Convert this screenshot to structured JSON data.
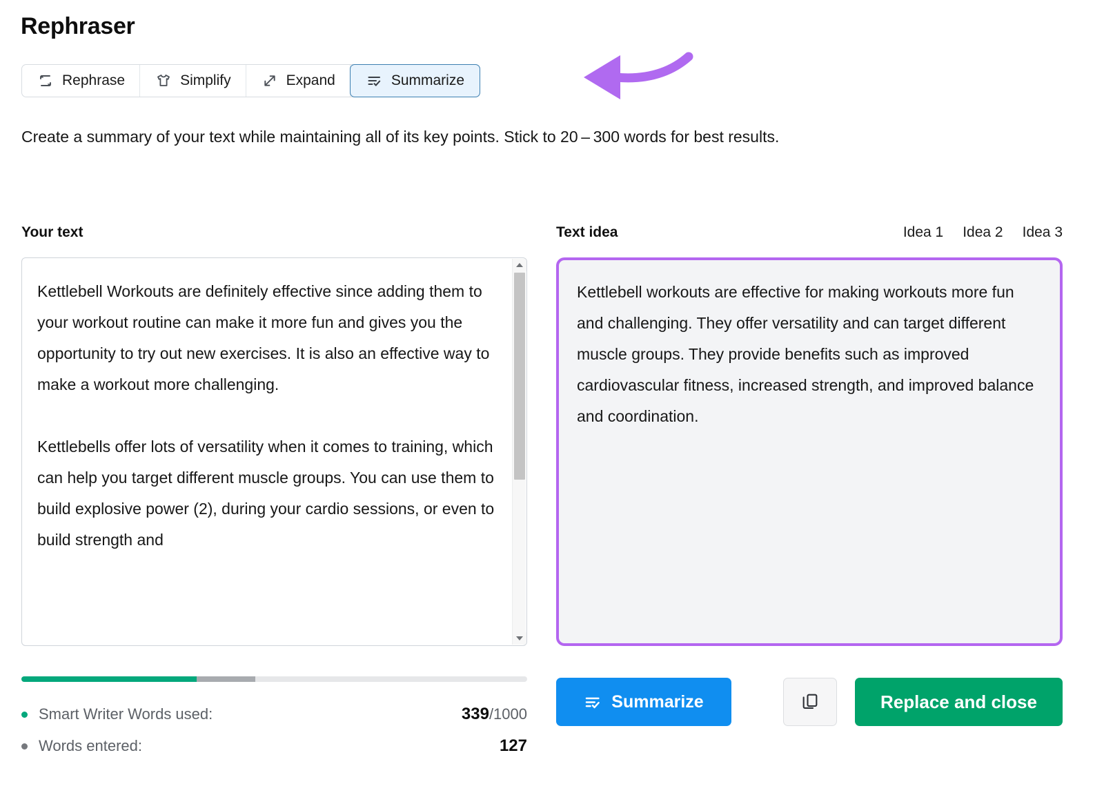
{
  "header": {
    "title": "Rephraser"
  },
  "tabs": [
    {
      "label": "Rephrase",
      "icon": "rephrase-loop-icon",
      "active": false
    },
    {
      "label": "Simplify",
      "icon": "tshirt-icon",
      "active": false
    },
    {
      "label": "Expand",
      "icon": "expand-arrows-icon",
      "active": false
    },
    {
      "label": "Summarize",
      "icon": "list-check-icon",
      "active": true
    }
  ],
  "description": "Create a summary of your text while maintaining all of its key points. Stick to 20 – 300 words for best results.",
  "left_panel": {
    "label": "Your text",
    "paragraphs": [
      "Kettlebell Workouts are definitely effective since adding them to your workout routine can make it more fun and gives you the opportunity to try out new exercises. It is also an effective way to make a workout more challenging.",
      "Kettlebells offer lots of versatility when it comes to training, which can help you target different muscle groups. You can use them to build explosive power (2), during your cardio sessions, or even to build strength and"
    ]
  },
  "right_panel": {
    "label": "Text idea",
    "idea_tabs": [
      "Idea 1",
      "Idea 2",
      "Idea 3"
    ],
    "idea_text": "Kettlebell workouts are effective for making workouts more fun and challenging. They offer versatility and can target different muscle groups. They provide benefits such as improved cardiovascular fitness, increased strength, and improved balance and coordination."
  },
  "stats": {
    "rows": [
      {
        "label": "Smart Writer Words used:",
        "value_bold": "339",
        "value_rest": "/1000",
        "bullet_color": "#04a87c"
      },
      {
        "label": "Words entered:",
        "value_bold": "127",
        "value_rest": "",
        "bullet_color": "#76797e"
      }
    ],
    "progress": {
      "green_percent": 34.6,
      "gray_percent": 11.6,
      "track_color": "#e6e7e9",
      "green_color": "#04a87c",
      "gray_color": "#a8abaf"
    }
  },
  "actions": {
    "summarize_label": "Summarize",
    "copy_icon": "copy-icon",
    "replace_label": "Replace and close"
  },
  "annotation": {
    "type": "arrow",
    "color": "#b06af0",
    "points_to": "Summarize"
  },
  "colors": {
    "accent_blue": "#108ef0",
    "accent_green": "#00a36a",
    "highlight_purple": "#b466f0",
    "tab_active_bg": "#e8f3fd",
    "tab_active_border": "#3c7fb1"
  }
}
